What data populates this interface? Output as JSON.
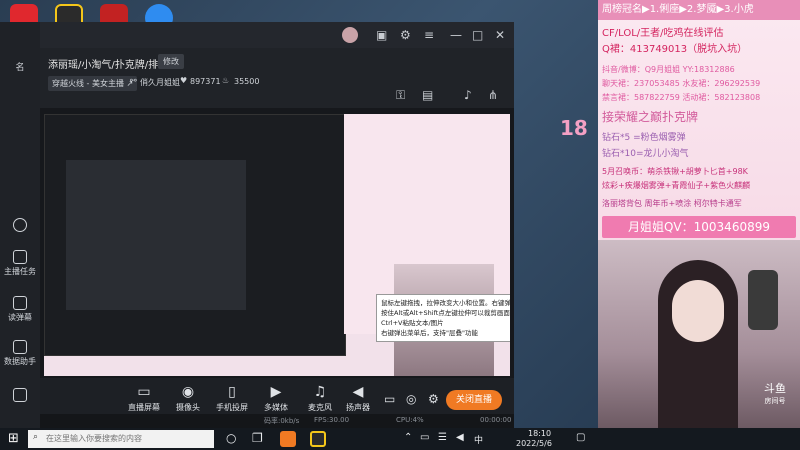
{
  "window": {
    "room_title": "添丽瑶/小淘气/扑克牌/排位",
    "edit_label": "修改",
    "category": "穿越火线 - 美女主播",
    "category_suffix": "↗",
    "chain_label": "俏久月姐姐",
    "fans_count": "897371",
    "heat_value": "35500"
  },
  "sidebar": {
    "top_label": "名",
    "items": [
      "主播任务",
      "读弹幕",
      "数据助手"
    ]
  },
  "controls": {
    "buttons": [
      "直播屏幕",
      "摄像头",
      "手机投屏",
      "多媒体",
      "麦克风",
      "扬声器"
    ],
    "close_live": "关闭直播"
  },
  "statusbar": {
    "bitrate": "码率:0kb/s",
    "fps": "FPS:30.00",
    "cpu": "CPU:4%",
    "time": "00:00:00"
  },
  "tooltip": {
    "lines": [
      "鼠标左键拖拽，拉伸改变大小和位置。右键弹出菜单",
      "按住Alt或Alt+Shift点左键拉伸可以裁剪画面",
      "Ctrl+V粘贴文本/图片",
      "右键弹出菜单后，支持\"层叠\"功能"
    ]
  },
  "overlay": {
    "header": "周榜冠名▶1.俐座▶2.梦魇▶3.小虎",
    "lines": [
      "CF/LOL/王者/吃鸡在线评估",
      "Q裙：413749013（脱坑入坑）",
      "抖音/微博：Q9月姐姐    YY:18312886",
      "聊天裙：237053485  水友裙：296292539",
      "禁言裙：587822759  活动裙：582123808",
      "接荣耀之巅扑克牌",
      "钻石*5 =粉色烟雾弹",
      "钻石*10=龙儿小淘气",
      "5月召唤币：萌杀铁锹+胡萝卜匕首+98K",
      "炫彩+疾爆烟雾弹+青霞仙子+紫色火麒麟",
      "洛丽塔背包  周年币+喷涂  柯尔特卡通军"
    ],
    "qv": "月姐姐QV：1003460899",
    "badge": "18",
    "cam_logo": "斗鱼",
    "cam_sub": "房间号"
  },
  "taskbar": {
    "search_placeholder": "在这里输入你要搜索的内容",
    "time": "18:10",
    "date": "2022/5/6",
    "lang": "中"
  },
  "colors": {
    "accent_pink": "#f07bb0",
    "orange": "#f07a23",
    "sidebar_bg": "#1f2227"
  }
}
